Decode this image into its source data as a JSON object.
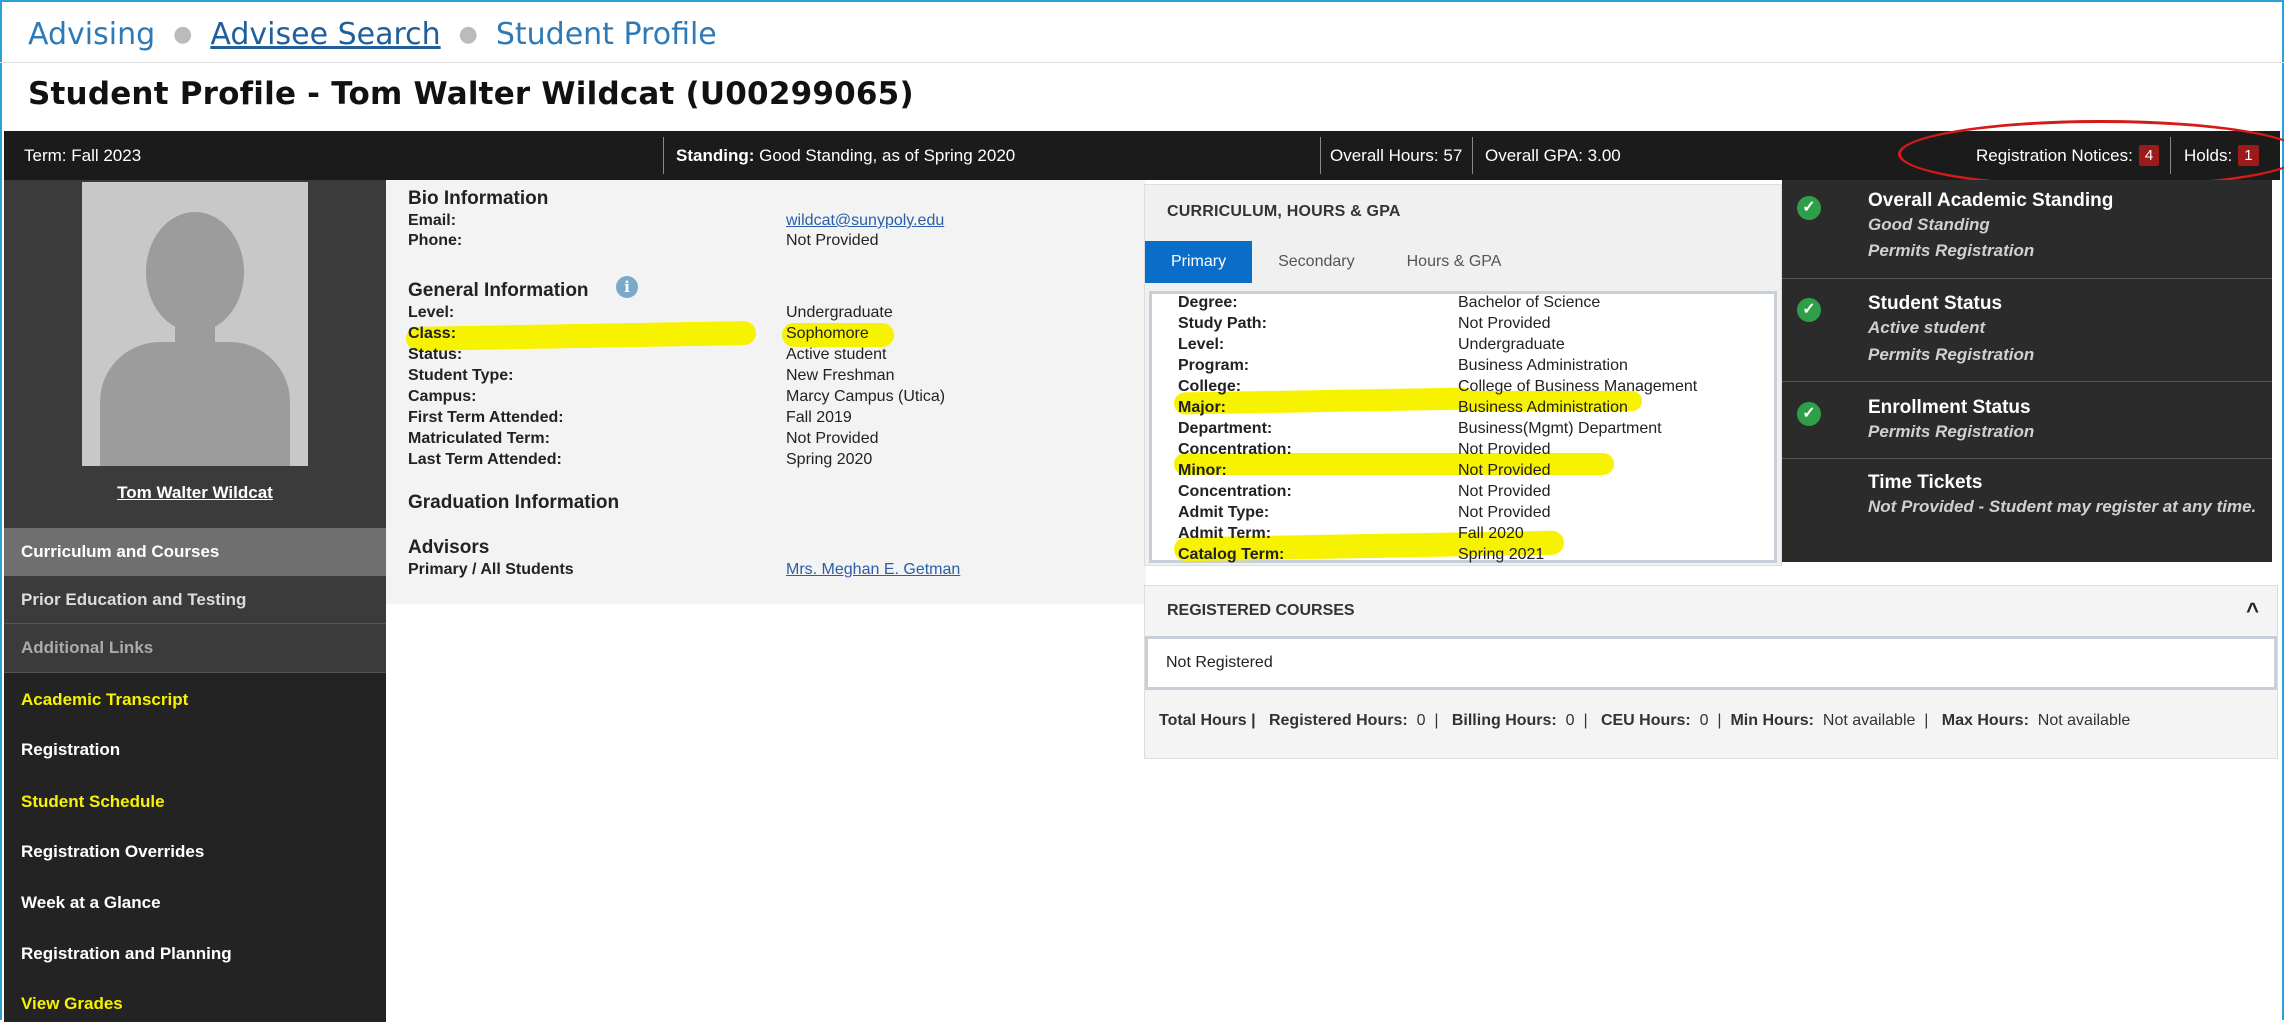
{
  "breadcrumb": {
    "item1": "Advising",
    "item2": "Advisee Search",
    "item3": "Student Profile"
  },
  "page_title": "Student Profile - Tom Walter Wildcat (U00299065)",
  "termbar": {
    "term_label": "Term:",
    "term_value": "Fall 2023",
    "standing_label": "Standing:",
    "standing_value": "Good Standing, as of Spring 2020",
    "hours_label": "Overall Hours:",
    "hours_value": "57",
    "gpa_label": "Overall GPA:",
    "gpa_value": "3.00",
    "notices_label": "Registration Notices:",
    "notices_count": "4",
    "holds_label": "Holds:",
    "holds_count": "1"
  },
  "sidebar": {
    "student_name": "Tom Walter Wildcat",
    "items": [
      "Curriculum and Courses",
      "Prior Education and Testing",
      "Additional Links",
      "Academic Transcript",
      "Registration",
      "Student Schedule",
      "Registration Overrides",
      "Week at a Glance",
      "Registration and Planning",
      "View Grades"
    ]
  },
  "bio": {
    "heading": "Bio Information",
    "email_label": "Email:",
    "email_value": "wildcat@sunypoly.edu",
    "phone_label": "Phone:",
    "phone_value": "Not Provided",
    "general_heading": "General Information",
    "info_icon": "i",
    "general": [
      {
        "label": "Level:",
        "value": "Undergraduate"
      },
      {
        "label": "Class:",
        "value": "Sophomore"
      },
      {
        "label": "Status:",
        "value": "Active student"
      },
      {
        "label": "Student Type:",
        "value": "New Freshman"
      },
      {
        "label": "Campus:",
        "value": "Marcy Campus (Utica)"
      },
      {
        "label": "First Term Attended:",
        "value": "Fall 2019"
      },
      {
        "label": "Matriculated Term:",
        "value": "Not Provided"
      },
      {
        "label": "Last Term Attended:",
        "value": "Spring 2020"
      }
    ],
    "graduation_heading": "Graduation Information",
    "advisors_heading": "Advisors",
    "advisor_label": "Primary / All Students",
    "advisor_name": "Mrs. Meghan E. Getman"
  },
  "curriculum": {
    "title": "CURRICULUM, HOURS & GPA",
    "tabs": [
      "Primary",
      "Secondary",
      "Hours & GPA"
    ],
    "rows": [
      {
        "label": "Degree:",
        "value": "Bachelor of Science"
      },
      {
        "label": "Study Path:",
        "value": "Not Provided"
      },
      {
        "label": "Level:",
        "value": "Undergraduate"
      },
      {
        "label": "Program:",
        "value": "Business Administration"
      },
      {
        "label": "College:",
        "value": "College of Business Management"
      },
      {
        "label": "Major:",
        "value": "Business Administration"
      },
      {
        "label": "Department:",
        "value": "Business(Mgmt) Department"
      },
      {
        "label": "Concentration:",
        "value": "Not Provided"
      },
      {
        "label": "Minor:",
        "value": "Not Provided"
      },
      {
        "label": "Concentration:",
        "value": "Not Provided"
      },
      {
        "label": "Admit Type:",
        "value": "Not Provided"
      },
      {
        "label": "Admit Term:",
        "value": "Fall 2020"
      },
      {
        "label": "Catalog Term:",
        "value": "Spring 2021"
      }
    ]
  },
  "holds_panel": {
    "check_icon": "✓",
    "items": [
      {
        "title": "Overall Academic Standing",
        "line1": "Good Standing",
        "line2": "Permits Registration"
      },
      {
        "title": "Student Status",
        "line1": "Active student",
        "line2": "Permits Registration"
      },
      {
        "title": "Enrollment Status",
        "line1": "Permits Registration",
        "line2": ""
      },
      {
        "title": "Time Tickets",
        "line1": "Not Provided - Student may register at any time.",
        "line2": ""
      }
    ]
  },
  "registered": {
    "title": "REGISTERED COURSES",
    "caret": "^",
    "status": "Not Registered",
    "total_label": "Total Hours |",
    "registered_label": "Registered Hours:",
    "registered_value": "0",
    "billing_label": "Billing Hours:",
    "billing_value": "0",
    "ceu_label": "CEU Hours:",
    "ceu_value": "0",
    "min_label": "Min Hours:",
    "min_value": "Not available",
    "max_label": "Max Hours:",
    "max_value": "Not available",
    "pipe": "|"
  },
  "colors": {
    "accent_blue": "#0a6ec8",
    "highlight_yellow": "#f7f200",
    "annotation_red": "#d51a1a",
    "check_green": "#2f9e48"
  }
}
